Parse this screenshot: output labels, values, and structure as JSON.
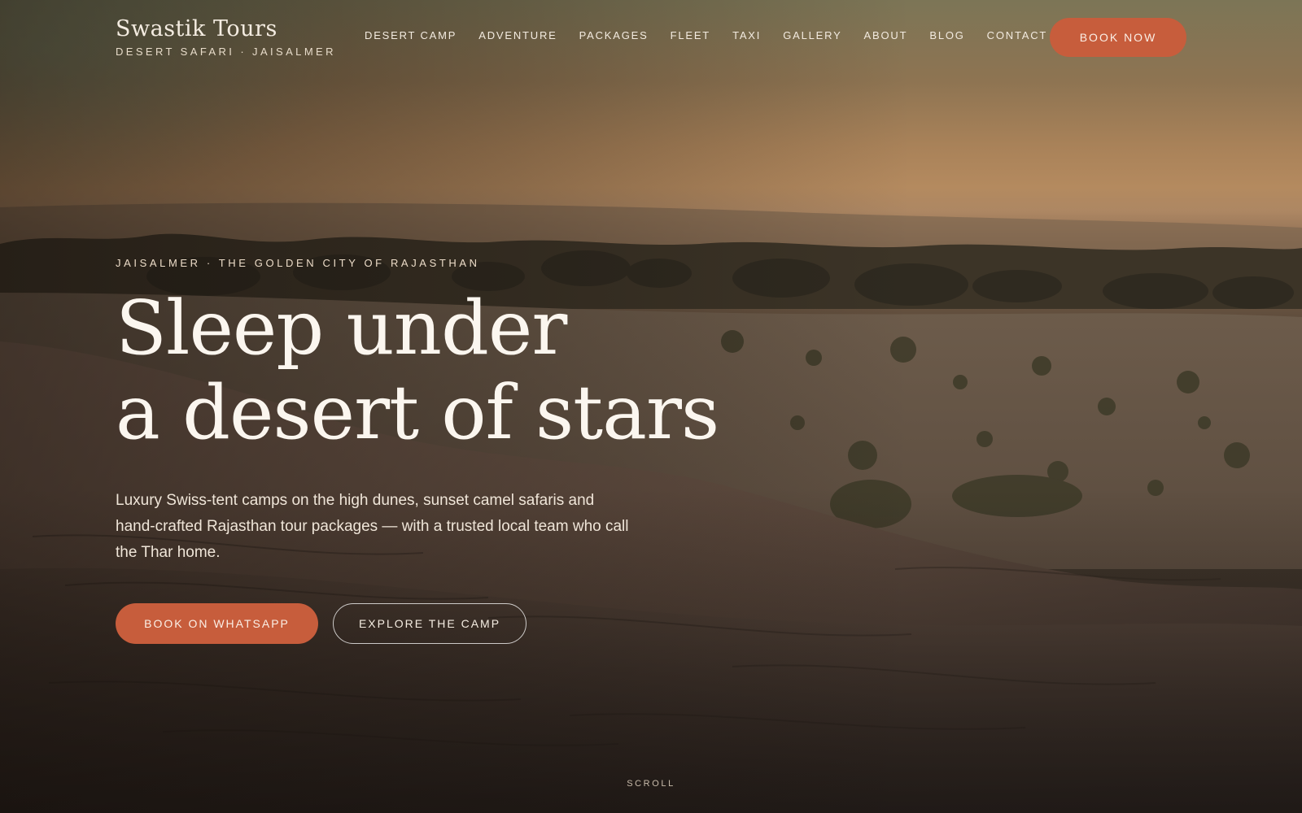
{
  "brand": {
    "name": "Swastik Tours",
    "tagline": "DESERT SAFARI · JAISALMER"
  },
  "nav": {
    "items": [
      {
        "label": "DESERT CAMP"
      },
      {
        "label": "ADVENTURE"
      },
      {
        "label": "PACKAGES"
      },
      {
        "label": "FLEET"
      },
      {
        "label": "TAXI"
      },
      {
        "label": "GALLERY"
      },
      {
        "label": "ABOUT"
      },
      {
        "label": "BLOG"
      },
      {
        "label": "CONTACT"
      }
    ],
    "book_now_label": "BOOK NOW"
  },
  "hero": {
    "eyebrow": "JAISALMER · THE GOLDEN CITY OF RAJASTHAN",
    "headline_line1": "Sleep under",
    "headline_line2": "a desert of stars",
    "lede": "Luxury Swiss-tent camps on the high dunes, sunset camel safaris and hand-crafted Rajasthan tour packages — with a trusted local team who call the Thar home.",
    "cta_primary": "BOOK ON WHATSAPP",
    "cta_secondary": "EXPLORE THE CAMP",
    "scroll_label": "SCROLL"
  },
  "colors": {
    "accent": "#c75d3c",
    "text_light": "#fbf6ef"
  }
}
